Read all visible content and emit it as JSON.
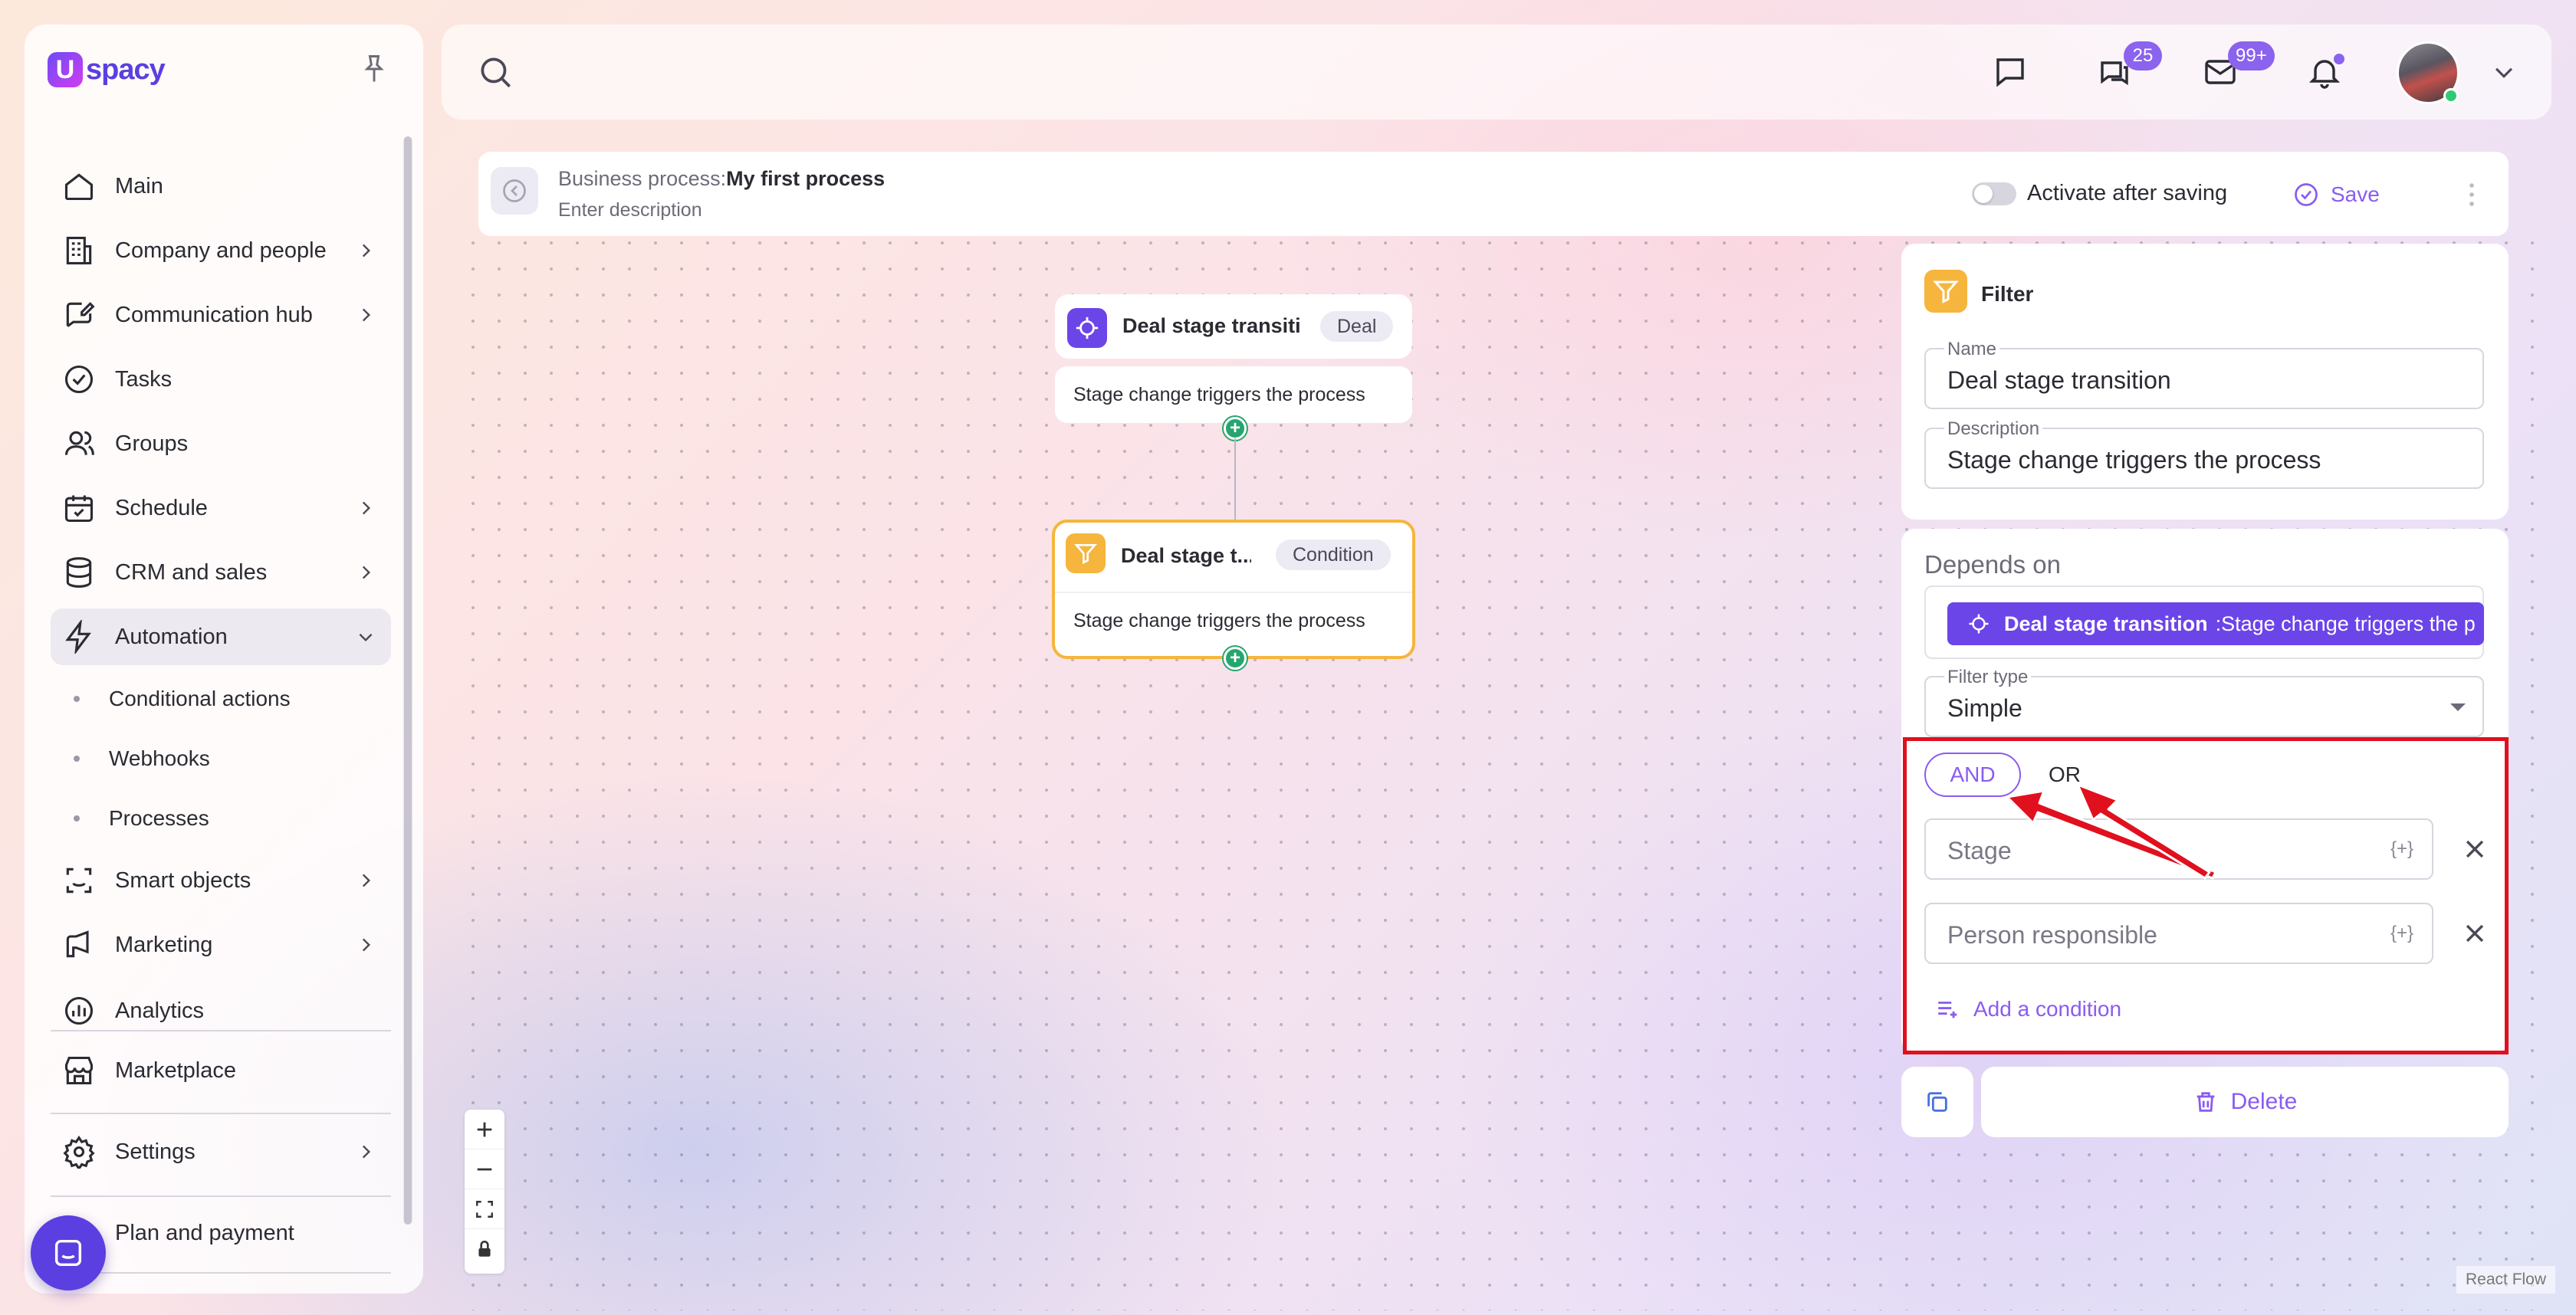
{
  "app": {
    "logo_text": "spacy"
  },
  "sidebar": {
    "items": [
      {
        "label": "Main",
        "icon": "home-icon"
      },
      {
        "label": "Company and people",
        "icon": "building-icon"
      },
      {
        "label": "Communication hub",
        "icon": "edit-chat-icon"
      },
      {
        "label": "Tasks",
        "icon": "check-circle-icon"
      },
      {
        "label": "Groups",
        "icon": "users-icon"
      },
      {
        "label": "Schedule",
        "icon": "calendar-icon"
      },
      {
        "label": "CRM and sales",
        "icon": "database-icon"
      },
      {
        "label": "Automation",
        "icon": "bolt-icon"
      },
      {
        "label": "Smart objects",
        "icon": "scan-icon"
      },
      {
        "label": "Marketing",
        "icon": "megaphone-icon"
      },
      {
        "label": "Analytics",
        "icon": "chart-icon"
      },
      {
        "label": "Marketplace",
        "icon": "store-icon"
      },
      {
        "label": "Settings",
        "icon": "gear-icon"
      },
      {
        "label": "Plan and payment",
        "icon": "card-icon"
      }
    ],
    "automation_sub": [
      "Conditional actions",
      "Webhooks",
      "Processes"
    ]
  },
  "topbar": {
    "chat_badge": "25",
    "mail_badge": "99+"
  },
  "process": {
    "label": "Business process:",
    "name": "My first process",
    "description": "Enter description",
    "activate_label": "Activate after saving",
    "save_label": "Save"
  },
  "nodes": [
    {
      "title": "Deal stage transitic",
      "tag": "Deal",
      "body": "Stage change triggers the process"
    },
    {
      "title": "Deal stage t...",
      "tag": "Condition",
      "body": "Stage change triggers the process"
    }
  ],
  "flow": {
    "watermark": "React Flow"
  },
  "panel": {
    "title": "Filter",
    "name_label": "Name",
    "name_value": "Deal stage transition",
    "desc_label": "Description",
    "desc_value": "Stage change triggers the process",
    "depends_label": "Depends on",
    "depends_chip_bold": "Deal stage transition",
    "depends_chip_rest": ":Stage change triggers the p",
    "filter_type_label": "Filter type",
    "filter_type_value": "Simple",
    "and_label": "AND",
    "or_label": "OR",
    "conditions": [
      {
        "placeholder": "Stage",
        "insert": "{+}"
      },
      {
        "placeholder": "Person responsible",
        "insert": "{+}"
      }
    ],
    "add_condition": "Add a condition",
    "delete_label": "Delete"
  },
  "colors": {
    "accent": "#8a5cf0",
    "highlight": "#e0101e",
    "filter": "#f6b53c",
    "trigger": "#6b45e8"
  }
}
